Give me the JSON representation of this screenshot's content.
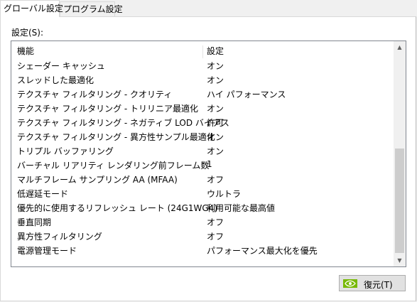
{
  "tabs": [
    {
      "label": "グローバル設定",
      "active": true
    },
    {
      "label": "プログラム設定",
      "active": false
    }
  ],
  "settings_label": "設定(S):",
  "table": {
    "headers": {
      "feature": "機能",
      "setting": "設定"
    },
    "rows": [
      {
        "feature": "シェーダー キャッシュ",
        "setting": "オン"
      },
      {
        "feature": "スレッドした最適化",
        "setting": "オン"
      },
      {
        "feature": "テクスチャ フィルタリング - クオリティ",
        "setting": "ハイ パフォーマンス"
      },
      {
        "feature": "テクスチャ フィルタリング - トリリニア最適化",
        "setting": "オン"
      },
      {
        "feature": "テクスチャ フィルタリング - ネガティブ LOD バイアス",
        "setting": "許可"
      },
      {
        "feature": "テクスチャ フィルタリング - 異方性サンプル最適化",
        "setting": "オン"
      },
      {
        "feature": "トリプル バッファリング",
        "setting": "オン"
      },
      {
        "feature": "バーチャル リアリティ レンダリング前フレーム数",
        "setting": "1"
      },
      {
        "feature": "マルチフレーム サンプリング AA (MFAA)",
        "setting": "オフ"
      },
      {
        "feature": "低遅延モード",
        "setting": "ウルトラ"
      },
      {
        "feature": "優先的に使用するリフレッシュ レート (24G1WG4)",
        "setting": "利用可能な最高値"
      },
      {
        "feature": "垂直同期",
        "setting": "オフ"
      },
      {
        "feature": "異方性フィルタリング",
        "setting": "オフ"
      },
      {
        "feature": "電源管理モード",
        "setting": "パフォーマンス最大化を優先"
      }
    ]
  },
  "restore_button": {
    "label": "復元(T)"
  },
  "colors": {
    "nvidia_green": "#76b900"
  }
}
